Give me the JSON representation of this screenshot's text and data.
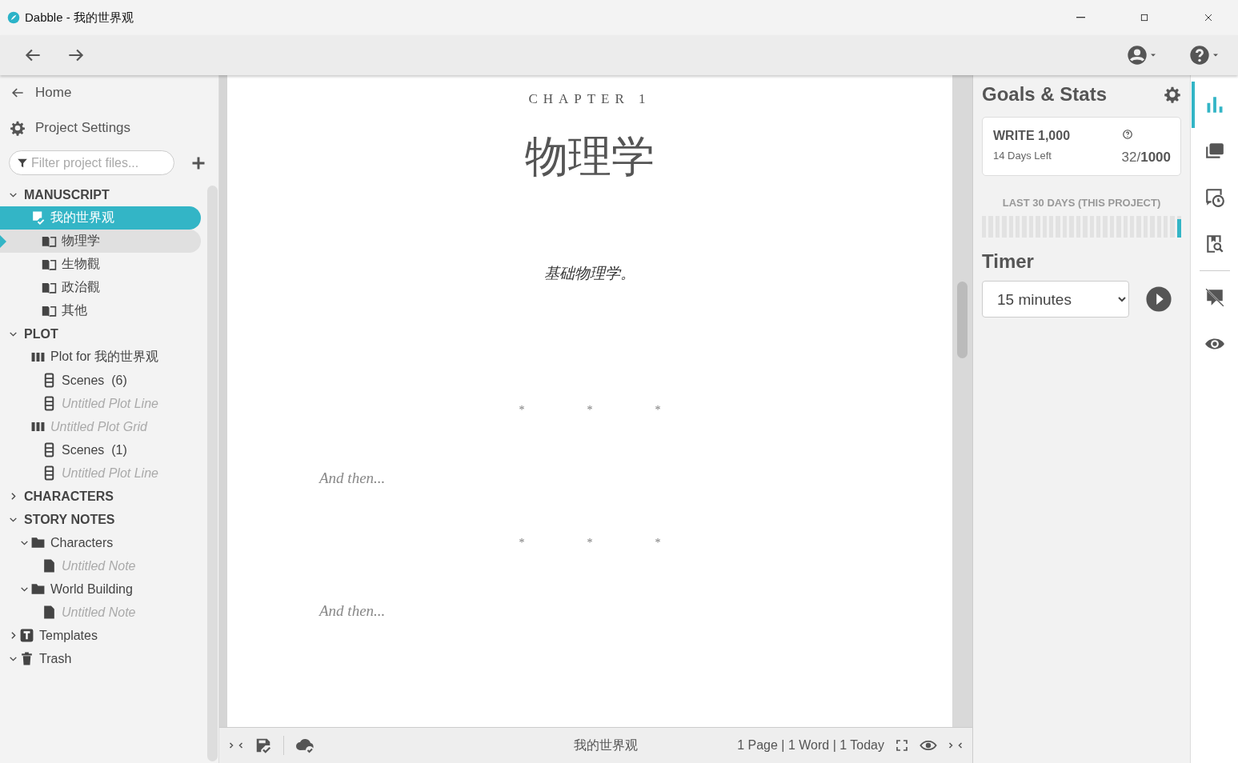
{
  "window": {
    "title": "Dabble - 我的世界观"
  },
  "sidebar": {
    "nav": [
      {
        "kind": "home",
        "label": "Home"
      },
      {
        "kind": "settings",
        "label": "Project Settings"
      }
    ],
    "filter": {
      "placeholder": "Filter project files..."
    },
    "tree": [
      {
        "kind": "section",
        "label": "MANUSCRIPT",
        "expanded": true,
        "selected": false,
        "active": false,
        "untitled": false,
        "children": [
          {
            "kind": "book",
            "label": "我的世界观",
            "selected": true,
            "active": false,
            "untitled": false,
            "children": [
              {
                "kind": "chapter",
                "label": "物理学",
                "selected": false,
                "active": true,
                "untitled": false
              },
              {
                "kind": "chapter",
                "label": "生物觀",
                "selected": false,
                "active": false,
                "untitled": false
              },
              {
                "kind": "chapter",
                "label": "政治觀",
                "selected": false,
                "active": false,
                "untitled": false
              },
              {
                "kind": "chapter",
                "label": "其他",
                "selected": false,
                "active": false,
                "untitled": false
              }
            ]
          }
        ]
      },
      {
        "kind": "section",
        "label": "PLOT",
        "expanded": true,
        "selected": false,
        "active": false,
        "untitled": false,
        "children": [
          {
            "kind": "grid",
            "label": "Plot for 我的世界观",
            "selected": false,
            "active": false,
            "untitled": false,
            "children": [
              {
                "kind": "line",
                "label": "Scenes  (6)",
                "selected": false,
                "active": false,
                "untitled": false
              },
              {
                "kind": "line",
                "label": "Untitled Plot Line",
                "selected": false,
                "active": false,
                "untitled": true
              }
            ]
          },
          {
            "kind": "grid",
            "label": "Untitled Plot Grid",
            "selected": false,
            "active": false,
            "untitled": true,
            "children": [
              {
                "kind": "line",
                "label": "Scenes  (1)",
                "selected": false,
                "active": false,
                "untitled": false
              },
              {
                "kind": "line",
                "label": "Untitled Plot Line",
                "selected": false,
                "active": false,
                "untitled": true
              }
            ]
          }
        ]
      },
      {
        "kind": "section",
        "label": "CHARACTERS",
        "expanded": false,
        "selected": false,
        "active": false,
        "untitled": false
      },
      {
        "kind": "section",
        "label": "STORY NOTES",
        "expanded": true,
        "selected": false,
        "active": false,
        "untitled": false,
        "children": [
          {
            "kind": "folder",
            "label": "Characters",
            "expanded": true,
            "selected": false,
            "active": false,
            "untitled": false,
            "children": [
              {
                "kind": "note",
                "label": "Untitled Note",
                "selected": false,
                "active": false,
                "untitled": true
              }
            ]
          },
          {
            "kind": "folder",
            "label": "World Building",
            "expanded": true,
            "selected": false,
            "active": false,
            "untitled": false,
            "children": [
              {
                "kind": "note",
                "label": "Untitled Note",
                "selected": false,
                "active": false,
                "untitled": true
              }
            ]
          }
        ]
      },
      {
        "kind": "templates",
        "label": "Templates",
        "expanded": false,
        "selected": false,
        "active": false,
        "untitled": false
      },
      {
        "kind": "trash",
        "label": "Trash",
        "expanded": true,
        "selected": false,
        "active": false,
        "untitled": false
      }
    ]
  },
  "editor": {
    "chapter_label": "CHAPTER 1",
    "title": "物理学",
    "blocks": [
      {
        "kind": "text",
        "text": "基础物理学。"
      },
      {
        "kind": "separator",
        "marks": [
          "*",
          "*",
          "*"
        ]
      },
      {
        "kind": "placeholder",
        "text": "And then..."
      },
      {
        "kind": "separator",
        "marks": [
          "*",
          "*",
          "*"
        ]
      },
      {
        "kind": "placeholder",
        "text": "And then..."
      }
    ]
  },
  "status_bar": {
    "document": "我的世界观",
    "stats": "1 Page | 1 Word | 1 Today"
  },
  "goals": {
    "title": "Goals & Stats",
    "goal": {
      "heading": "WRITE 1,000",
      "remaining": "14 Days Left",
      "written": "32/",
      "target": "1000"
    },
    "history": {
      "label": "LAST 30 DAYS (THIS PROJECT)",
      "days": [
        {
          "level": 0
        },
        {
          "level": 0
        },
        {
          "level": 0
        },
        {
          "level": 0
        },
        {
          "level": 0
        },
        {
          "level": 0
        },
        {
          "level": 0
        },
        {
          "level": 0
        },
        {
          "level": 0
        },
        {
          "level": 0
        },
        {
          "level": 0
        },
        {
          "level": 0
        },
        {
          "level": 0
        },
        {
          "level": 0
        },
        {
          "level": 0
        },
        {
          "level": 0
        },
        {
          "level": 0
        },
        {
          "level": 0
        },
        {
          "level": 0
        },
        {
          "level": 0
        },
        {
          "level": 0
        },
        {
          "level": 0
        },
        {
          "level": 0
        },
        {
          "level": 0
        },
        {
          "level": 0
        },
        {
          "level": 0
        },
        {
          "level": 0
        },
        {
          "level": 0
        },
        {
          "level": 0
        },
        {
          "level": 0.85
        }
      ]
    },
    "timer": {
      "title": "Timer",
      "duration": "15 minutes"
    }
  },
  "rail": {
    "top": [
      {
        "kind": "stats",
        "selected": true
      },
      {
        "kind": "cards",
        "selected": false
      },
      {
        "kind": "history",
        "selected": false
      },
      {
        "kind": "search",
        "selected": false
      }
    ],
    "bottom": [
      {
        "kind": "comments-off",
        "selected": false
      },
      {
        "kind": "preview",
        "selected": false
      }
    ]
  }
}
